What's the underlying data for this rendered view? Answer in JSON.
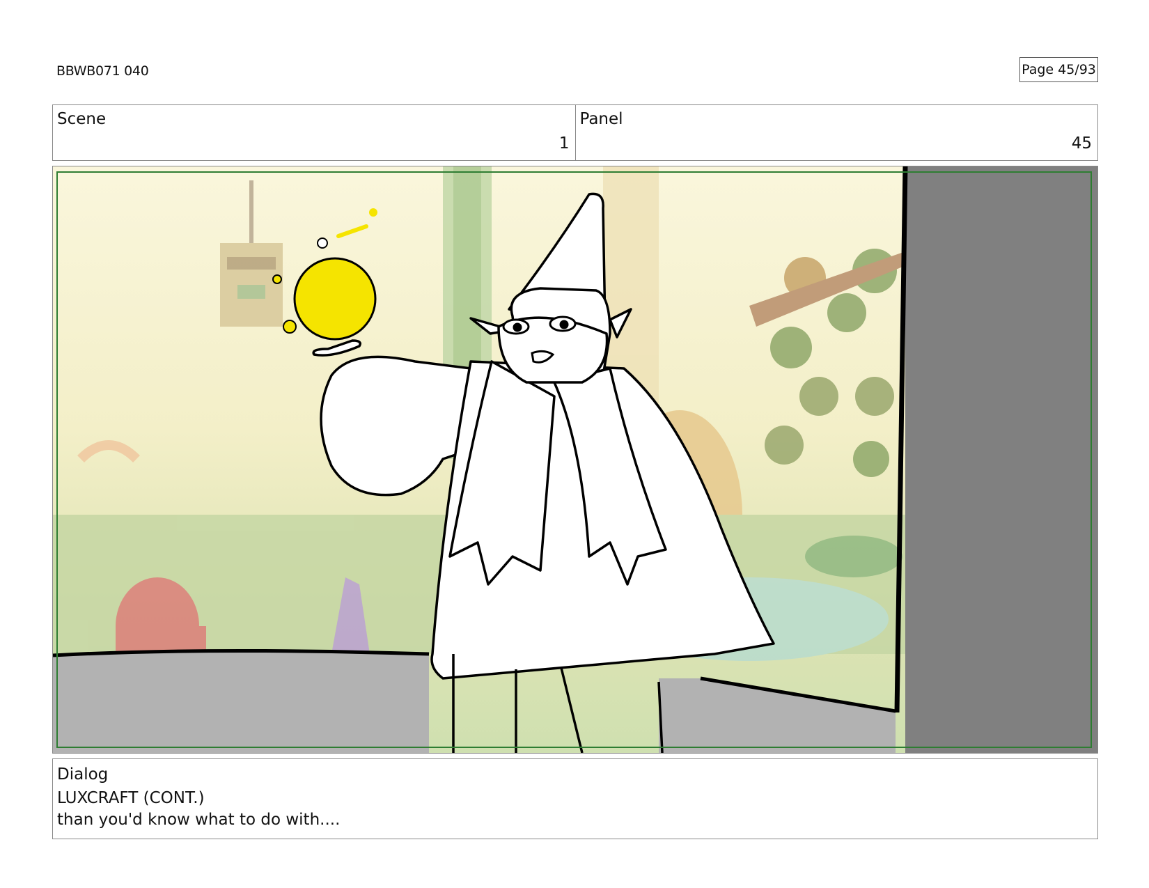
{
  "header": {
    "doc_id": "BBWB071 040",
    "page": "Page 45/93"
  },
  "scene": {
    "label": "Scene",
    "value": "1"
  },
  "panel": {
    "label": "Panel",
    "value": "45"
  },
  "storyboard_frame": {
    "description_icon": "wizard-sketch-illustration",
    "safe_area_color": "#2e7d32",
    "magic_orb_color": "#f5e400",
    "wall_color": "#808080",
    "floor_color": "#b0b0b0"
  },
  "dialog": {
    "label": "Dialog",
    "character": "LUXCRAFT (CONT.)",
    "line": "than you'd know what to do with...."
  }
}
